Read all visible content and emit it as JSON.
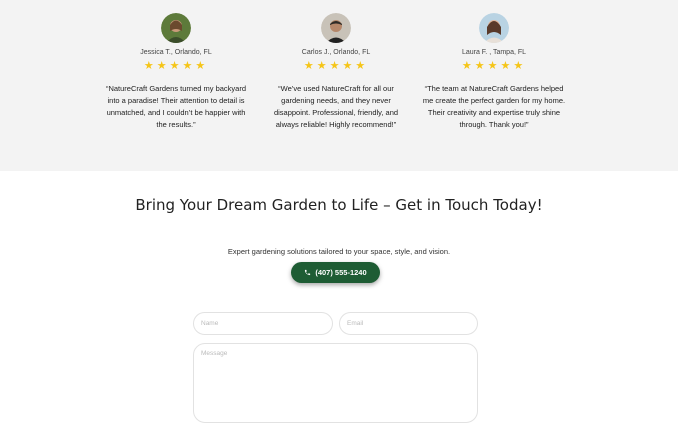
{
  "testimonials": [
    {
      "author": "Jessica T., Orlando, FL",
      "rating": 5,
      "quote": "“NatureCraft Gardens turned my backyard into a paradise! Their attention to detail is unmatched, and I couldn’t be happier with the results.”"
    },
    {
      "author": "Carlos J., Orlando, FL",
      "rating": 5,
      "quote": "“We’ve used NatureCraft for all our gardening needs, and they never disappoint. Professional, friendly, and always reliable! Highly recommend!”"
    },
    {
      "author": "Laura F. , Tampa, FL",
      "rating": 5,
      "quote": "“The team at NatureCraft Gardens helped me create the perfect garden for my home. Their creativity and expertise truly shine through. Thank you!”"
    }
  ],
  "cta": {
    "heading": "Bring Your Dream Garden to Life – Get in Touch Today!",
    "subtext": "Expert gardening solutions tailored to your space, style, and vision.",
    "phone_label": "(407) 555-1240"
  },
  "form": {
    "name_placeholder": "Name",
    "email_placeholder": "Email",
    "message_placeholder": "Message"
  },
  "colors": {
    "accent": "#1e5c34",
    "star": "#f5c518",
    "section_bg": "#f3f3f3"
  },
  "icons": {
    "star": "star-icon",
    "phone": "phone-icon",
    "avatar": "avatar"
  }
}
